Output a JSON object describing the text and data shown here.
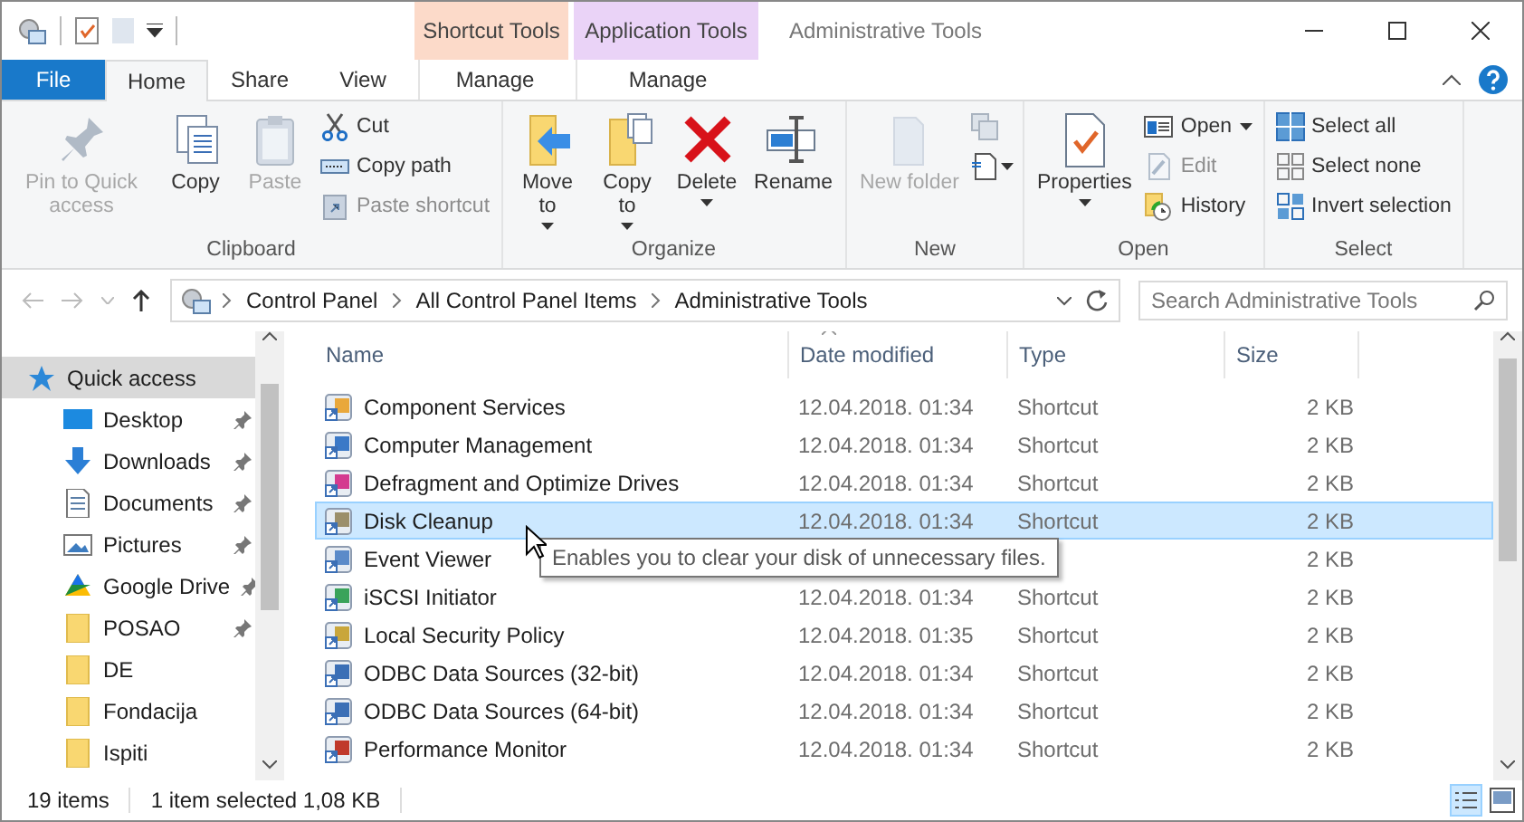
{
  "window": {
    "title": "Administrative Tools"
  },
  "context_groups": [
    {
      "label": "Shortcut Tools",
      "color": "#fcdac9",
      "tab": "Manage"
    },
    {
      "label": "Application Tools",
      "color": "#ead3f7",
      "tab": "Manage"
    }
  ],
  "ribbon_tabs": [
    {
      "label": "File",
      "kind": "file",
      "selected": false
    },
    {
      "label": "Home",
      "kind": "tab",
      "selected": true
    },
    {
      "label": "Share",
      "kind": "tab",
      "selected": false
    },
    {
      "label": "View",
      "kind": "tab",
      "selected": false
    }
  ],
  "ribbon_groups": [
    {
      "label": "Clipboard",
      "large": [
        {
          "label": "Pin to Quick access",
          "disabled": true,
          "dropdown": false
        },
        {
          "label": "Copy",
          "disabled": false,
          "dropdown": false
        },
        {
          "label": "Paste",
          "disabled": true,
          "dropdown": false
        }
      ],
      "small": [
        {
          "label": "Cut",
          "disabled": false,
          "dropdown": false
        },
        {
          "label": "Copy path",
          "disabled": false,
          "dropdown": false
        },
        {
          "label": "Paste shortcut",
          "disabled": true,
          "dropdown": false
        }
      ]
    },
    {
      "label": "Organize",
      "large": [
        {
          "label": "Move to",
          "disabled": false,
          "dropdown": true
        },
        {
          "label": "Copy to",
          "disabled": false,
          "dropdown": true
        },
        {
          "label": "Delete",
          "disabled": false,
          "dropdown": true
        },
        {
          "label": "Rename",
          "disabled": false,
          "dropdown": false
        }
      ]
    },
    {
      "label": "New",
      "large": [
        {
          "label": "New folder",
          "disabled": true,
          "dropdown": false
        }
      ]
    },
    {
      "label": "Open",
      "large": [
        {
          "label": "Properties",
          "disabled": false,
          "dropdown": true
        }
      ],
      "small": [
        {
          "label": "Open",
          "disabled": false,
          "dropdown": true
        },
        {
          "label": "Edit",
          "disabled": true,
          "dropdown": false
        },
        {
          "label": "History",
          "disabled": false,
          "dropdown": false
        }
      ]
    },
    {
      "label": "Select",
      "small": [
        {
          "label": "Select all",
          "disabled": false,
          "dropdown": false
        },
        {
          "label": "Select none",
          "disabled": false,
          "dropdown": false
        },
        {
          "label": "Invert selection",
          "disabled": false,
          "dropdown": false
        }
      ]
    }
  ],
  "address_bar": {
    "crumbs": [
      "Control Panel",
      "All Control Panel Items",
      "Administrative Tools"
    ]
  },
  "search": {
    "placeholder": "Search Administrative Tools"
  },
  "sidebar": {
    "items": [
      {
        "label": "Quick access",
        "selected": true,
        "children": [
          {
            "label": "Desktop",
            "pinned": true,
            "selected": false
          },
          {
            "label": "Downloads",
            "pinned": true,
            "selected": false
          },
          {
            "label": "Documents",
            "pinned": true,
            "selected": false
          },
          {
            "label": "Pictures",
            "pinned": true,
            "selected": false
          },
          {
            "label": "Google Drive",
            "pinned": true,
            "selected": false
          },
          {
            "label": "POSAO",
            "pinned": true,
            "selected": false
          },
          {
            "label": "DE",
            "pinned": false,
            "selected": false
          },
          {
            "label": "Fondacija",
            "pinned": false,
            "selected": false
          },
          {
            "label": "Ispiti",
            "pinned": false,
            "selected": false
          }
        ]
      }
    ]
  },
  "table": {
    "columns": [
      "Name",
      "Date modified",
      "Type",
      "Size"
    ],
    "rows": [
      {
        "name": "Component Services",
        "date": "12.04.2018. 01:34",
        "type": "Shortcut",
        "size": "2 KB",
        "selected": false
      },
      {
        "name": "Computer Management",
        "date": "12.04.2018. 01:34",
        "type": "Shortcut",
        "size": "2 KB",
        "selected": false
      },
      {
        "name": "Defragment and Optimize Drives",
        "date": "12.04.2018. 01:34",
        "type": "Shortcut",
        "size": "2 KB",
        "selected": false
      },
      {
        "name": "Disk Cleanup",
        "date": "12.04.2018. 01:34",
        "type": "Shortcut",
        "size": "2 KB",
        "selected": true
      },
      {
        "name": "Event Viewer",
        "size": "2 KB",
        "selected": false
      },
      {
        "name": "iSCSI Initiator",
        "date": "12.04.2018. 01:34",
        "type": "Shortcut",
        "size": "2 KB",
        "selected": false
      },
      {
        "name": "Local Security Policy",
        "date": "12.04.2018. 01:35",
        "type": "Shortcut",
        "size": "2 KB",
        "selected": false
      },
      {
        "name": "ODBC Data Sources (32-bit)",
        "date": "12.04.2018. 01:34",
        "type": "Shortcut",
        "size": "2 KB",
        "selected": false
      },
      {
        "name": "ODBC Data Sources (64-bit)",
        "date": "12.04.2018. 01:34",
        "type": "Shortcut",
        "size": "2 KB",
        "selected": false
      },
      {
        "name": "Performance Monitor",
        "date": "12.04.2018. 01:34",
        "type": "Shortcut",
        "size": "2 KB",
        "selected": false
      }
    ]
  },
  "tooltip": {
    "text": "Enables you to clear your disk of unnecessary files."
  },
  "status_bar": {
    "item_count": "19 items",
    "selection": "1 item selected",
    "selection_size": "1,08 KB"
  },
  "view_buttons": [
    {
      "selected": true
    },
    {
      "selected": false
    }
  ]
}
